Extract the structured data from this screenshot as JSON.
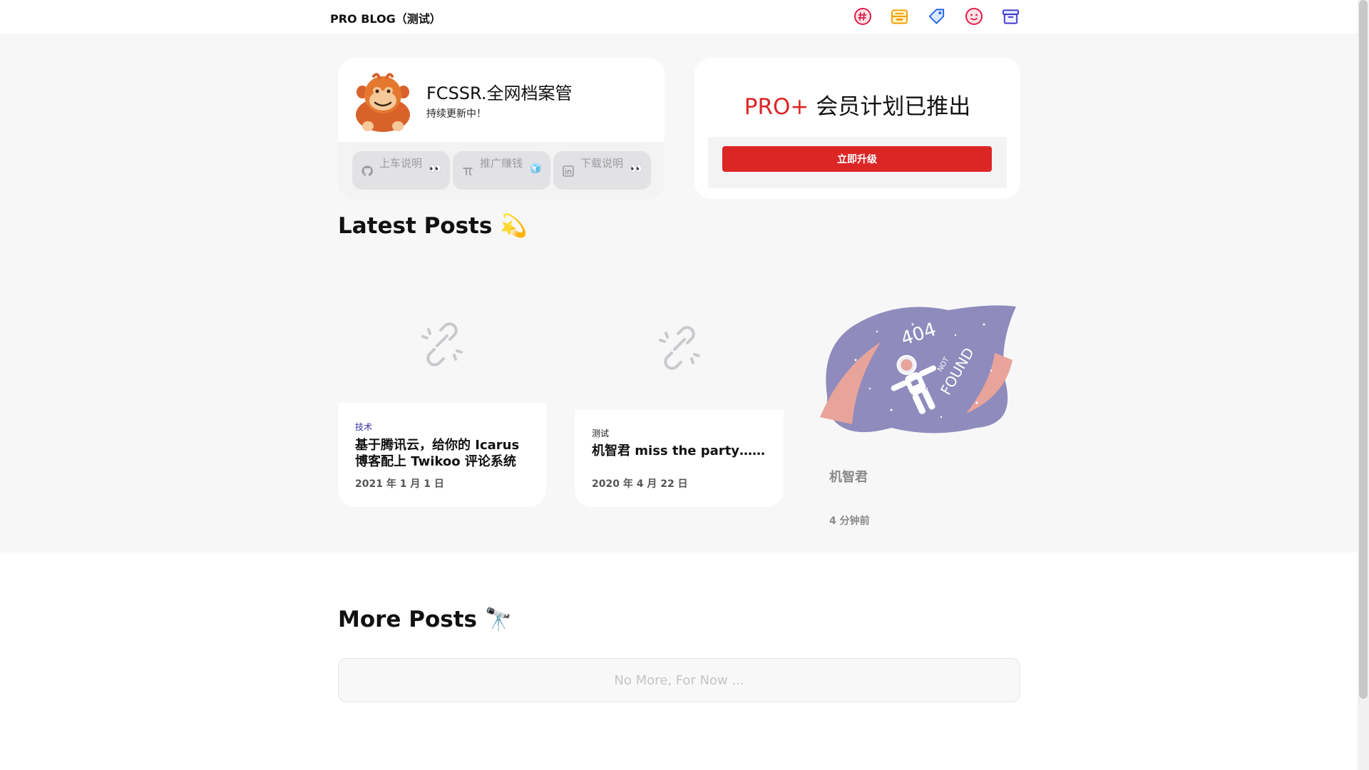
{
  "header": {
    "brand": "PRO BLOG（测试）",
    "icons": [
      "hashtag-icon",
      "inbox-stack-icon",
      "tag-icon",
      "smiley-face-icon",
      "archive-box-icon"
    ]
  },
  "profile": {
    "name": "FCSSR.全网档案管",
    "bio": "持续更新中！",
    "links": [
      {
        "label": "上车说明",
        "icon": "github-icon",
        "emoji": "👀"
      },
      {
        "label": "推广赚钱",
        "icon": "pi-icon",
        "emoji": "🧊"
      },
      {
        "label": "下载说明",
        "icon": "linkedin-icon",
        "emoji": "👀"
      }
    ]
  },
  "pro": {
    "title_accent": "PRO+",
    "title_rest": " 会员计划已推出",
    "button": "立即升级"
  },
  "latest": {
    "heading": "Latest Posts 💫",
    "posts": [
      {
        "tag": "技术",
        "title": "基于腾讯云，给你的 Icarus 博客配上 Twikoo 评论系统",
        "date": "2021 年 1 月 1 日"
      },
      {
        "tag": "测试",
        "title": "机智君 miss the party……",
        "date": "2020 年 4 月 22 日"
      },
      {
        "tag": "",
        "title": "机智君",
        "date": "4 分钟前",
        "image_text": [
          "404",
          "NOT",
          "FOUND"
        ]
      }
    ]
  },
  "more": {
    "heading": "More Posts 🔭",
    "empty": "No More, For Now ..."
  },
  "colors": {
    "accent_red": "#dc2626",
    "tag_blue": "#3730a3",
    "band_gray": "#f7f7f8"
  }
}
